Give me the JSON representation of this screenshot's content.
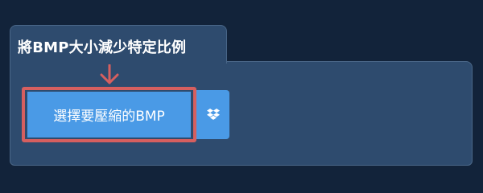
{
  "tool": {
    "title": "將BMP大小減少特定比例"
  },
  "upload": {
    "select_button_label": "選擇要壓縮的BMP",
    "dropbox_icon": "dropbox-icon"
  },
  "annotation": {
    "arrow_icon": "arrow-down-icon",
    "highlight_color": "#d65f5f"
  },
  "colors": {
    "background": "#12233a",
    "panel": "#2e4b6e",
    "button": "#4a9ae6"
  }
}
